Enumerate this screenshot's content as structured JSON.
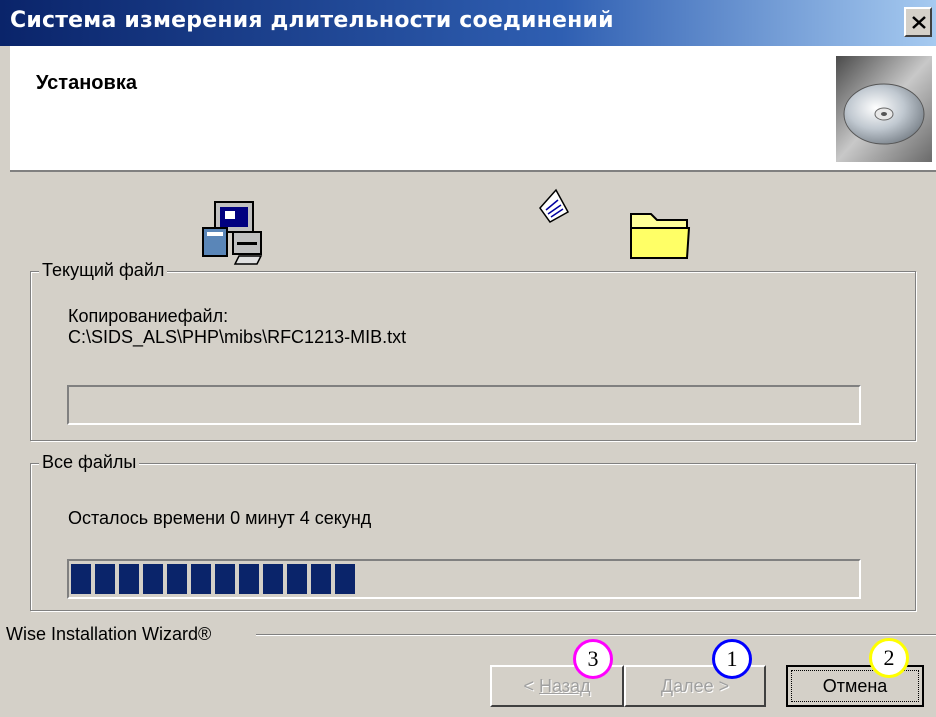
{
  "window": {
    "title": "Система измерения длительности соединений",
    "close_glyph": "×"
  },
  "header": {
    "title": "Установка",
    "icon": "cd-disc-icon"
  },
  "current_file": {
    "group_label": "Текущий файл",
    "action_label": "Копированиефайл:",
    "path": "C:\\SIDS_ALS\\PHP\\mibs\\RFC1213-MIB.txt",
    "progress_fraction": 0.0
  },
  "all_files": {
    "group_label": "Все файлы",
    "time_remaining": "Осталось времени 0 минут 4 секунд",
    "progress_blocks": 12,
    "progress_color": "#0a246a"
  },
  "footer": {
    "wizard_label": "Wise Installation Wizard®",
    "buttons": {
      "back": {
        "prefix": "< ",
        "label": "Назад",
        "enabled": false
      },
      "next": {
        "label": "Далее >",
        "enabled": false
      },
      "cancel": {
        "label": "Отмена",
        "enabled": true
      }
    }
  },
  "markers": [
    {
      "id": "3",
      "color": "#ff00ff"
    },
    {
      "id": "1",
      "color": "#0000ff"
    },
    {
      "id": "2",
      "color": "#ffff00"
    }
  ],
  "icons": [
    "computer-icon",
    "paper-sheet-icon",
    "folder-icon",
    "cd-disc-icon",
    "close-icon"
  ]
}
